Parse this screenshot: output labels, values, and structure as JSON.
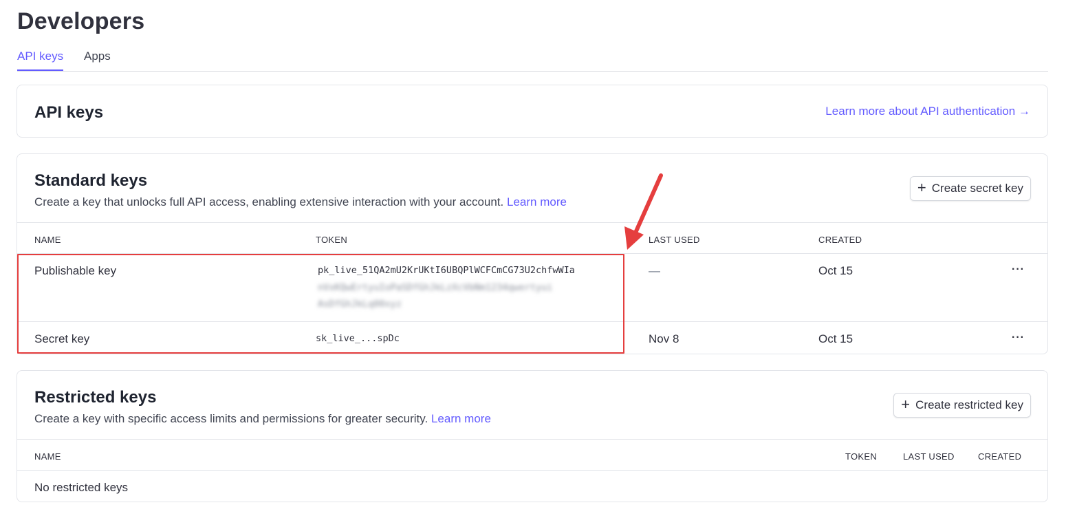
{
  "header": {
    "title": "Developers",
    "tabs": [
      {
        "label": "API keys",
        "active": true
      },
      {
        "label": "Apps",
        "active": false
      }
    ]
  },
  "api_keys_card": {
    "title": "API keys",
    "link": "Learn more about API authentication →"
  },
  "standard": {
    "title": "Standard keys",
    "description": "Create a key that unlocks full API access, enabling extensive interaction with your account.",
    "learn_more": "Learn more",
    "create_button": "Create secret key",
    "columns": [
      "NAME",
      "TOKEN",
      "LAST USED",
      "CREATED"
    ],
    "rows": [
      {
        "name": "Publishable key",
        "token": "pk_live_51QA2mU2KrUKtI6UBQPlWCFCmCG73U2chfwWIa",
        "token_blurred_1": "nVxKQwErtyuIoPaSDfGhJkLzXcVbNm1234qwertyui",
        "token_blurred_2": "AsDfGhJkLq00xyz",
        "last_used": "—",
        "created": "Oct 15",
        "menu": "···"
      },
      {
        "name": "Secret key",
        "token": "sk_live_...spDc",
        "last_used": "Nov 8",
        "created": "Oct 15",
        "menu": "···"
      }
    ]
  },
  "restricted": {
    "title": "Restricted keys",
    "description": "Create a key with specific access limits and permissions for greater security.",
    "learn_more": "Learn more",
    "create_button": "Create restricted key",
    "columns": [
      "NAME",
      "TOKEN",
      "LAST USED",
      "CREATED"
    ],
    "empty": "No restricted keys"
  },
  "colors": {
    "accent": "#635bff",
    "annotation": "#e53e3e"
  },
  "icons": {
    "plus": "plus-icon",
    "more": "more-horizontal-icon",
    "annotation_arrow": "arrow-icon"
  }
}
